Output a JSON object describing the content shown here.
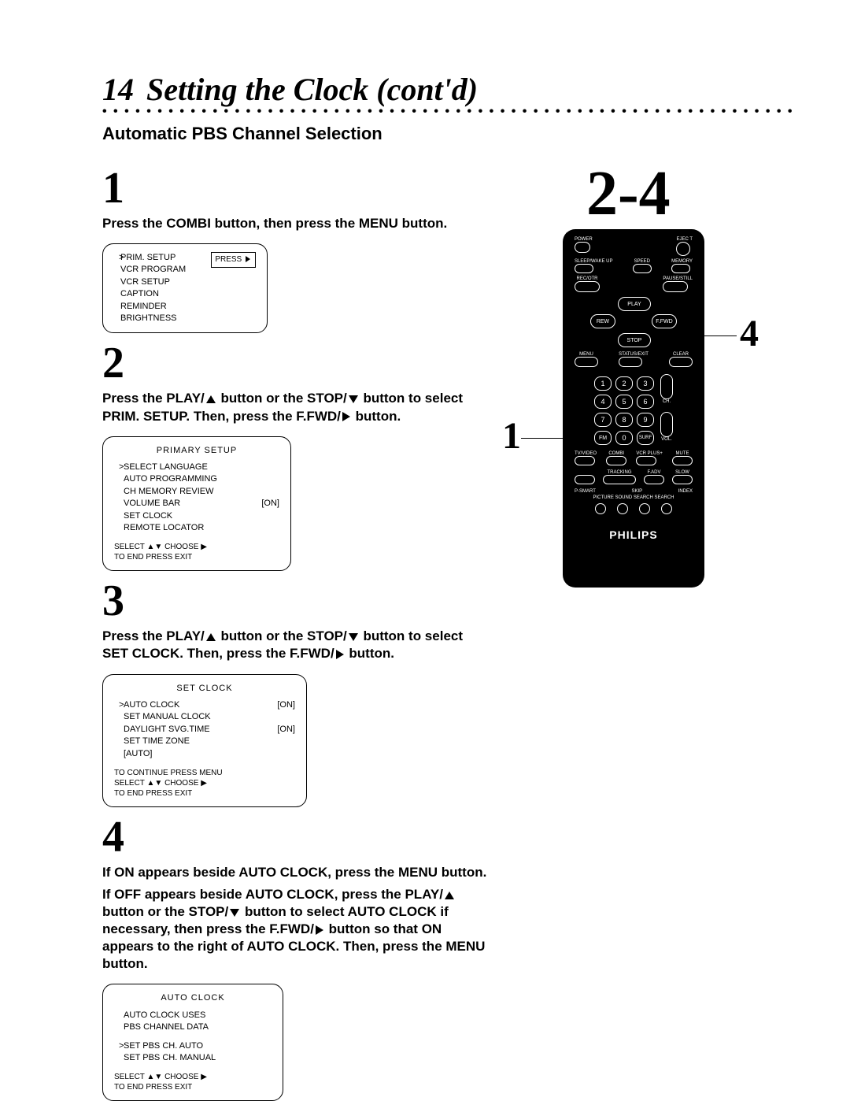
{
  "page_number": "14",
  "title": "Setting the Clock (cont'd)",
  "subtitle": "Automatic PBS Channel Selection",
  "right_big": "2-4",
  "callout_left": "1",
  "callout_right": "4",
  "brand": "PHILIPS",
  "steps": {
    "s1": {
      "num": "1",
      "text": "Press the COMBI button, then press the MENU button."
    },
    "s2": {
      "num": "2",
      "text_a": "Press the PLAY/",
      "text_b": " button or the STOP/",
      "text_c": " button to select PRIM. SETUP. Then, press the F.FWD/",
      "text_d": " button."
    },
    "s3": {
      "num": "3",
      "text_a": "Press the PLAY/",
      "text_b": " button or the STOP/",
      "text_c": " button to select SET CLOCK. Then, press the F.FWD/",
      "text_d": " button."
    },
    "s4": {
      "num": "4",
      "p1_a": "If ON appears beside AUTO CLOCK, press the MENU button.",
      "p2_a": "If OFF appears beside AUTO CLOCK, press the PLAY/",
      "p2_b": " button or the STOP/",
      "p2_c": " button to select  AUTO CLOCK if necessary, then press the F.FWD/",
      "p2_d": " button so that ON appears to the right of AUTO CLOCK. Then, press the MENU button."
    }
  },
  "osd1": {
    "press": "PRESS",
    "items": [
      "PRIM. SETUP",
      "VCR PROGRAM",
      "VCR SETUP",
      "CAPTION",
      "REMINDER",
      "BRIGHTNESS"
    ]
  },
  "osd2": {
    "hdr": "PRIMARY SETUP",
    "items": [
      {
        "l": "SELECT LANGUAGE",
        "r": ""
      },
      {
        "l": "AUTO PROGRAMMING",
        "r": ""
      },
      {
        "l": "CH MEMORY REVIEW",
        "r": ""
      },
      {
        "l": "VOLUME BAR",
        "r": "[ON]"
      },
      {
        "l": "SET CLOCK",
        "r": ""
      },
      {
        "l": "REMOTE LOCATOR",
        "r": ""
      }
    ],
    "foot1": "SELECT ▲▼ CHOOSE ▶",
    "foot2": "TO  END  PRESS  EXIT"
  },
  "osd3": {
    "hdr": "SET CLOCK",
    "items": [
      {
        "l": "AUTO CLOCK",
        "r": "[ON]"
      },
      {
        "l": "SET MANUAL CLOCK",
        "r": ""
      },
      {
        "l": "DAYLIGHT SVG.TIME",
        "r": "[ON]"
      },
      {
        "l": "SET TIME ZONE",
        "r": ""
      },
      {
        "l": "    [AUTO]",
        "r": ""
      }
    ],
    "foot0": "TO CONTINUE PRESS MENU",
    "foot1": "SELECT ▲▼ CHOOSE ▶",
    "foot2": "TO  END  PRESS  EXIT"
  },
  "osd4": {
    "hdr": "AUTO CLOCK",
    "lines": [
      "AUTO CLOCK USES",
      "PBS CHANNEL DATA"
    ],
    "items": [
      {
        "l": "SET PBS CH.   AUTO"
      },
      {
        "l": "SET PBS CH.   MANUAL"
      }
    ],
    "foot1": "SELECT ▲▼ CHOOSE ▶",
    "foot2": "TO  END  PRESS  EXIT"
  },
  "remote": {
    "top_labels": {
      "power": "POWER",
      "eject": "EJEC T",
      "sleep": "SLEEP/WAKE UP",
      "speed": "SPEED",
      "memory": "MEMORY",
      "rec": "REC/OTR",
      "pause": "PAUSE/STILL"
    },
    "transport": {
      "play": "PLAY",
      "rew": "REW",
      "ffwd": "F.FWD",
      "stop": "STOP"
    },
    "row": {
      "menu": "MENU",
      "status": "STATUS/EXIT",
      "clear": "CLEAR"
    },
    "side": {
      "ch": "CH.",
      "vol": "VOL."
    },
    "numrow": [
      "1",
      "2",
      "3",
      "4",
      "5",
      "6",
      "7",
      "8",
      "9",
      "FM",
      "0",
      "SURF"
    ],
    "mid": {
      "tvvcr": "TV/VIDEO",
      "combi": "COMBI",
      "vcrplus": "VCR PLUS+",
      "mute": "MUTE",
      "tracking": "TRACKING",
      "adv": "F.ADV",
      "slow": "SLOW",
      "smart": "P-SMART",
      "skip": "SKIP",
      "index": "INDEX",
      "ps": "PICTURE  SOUND  SEARCH  SEARCH"
    }
  }
}
